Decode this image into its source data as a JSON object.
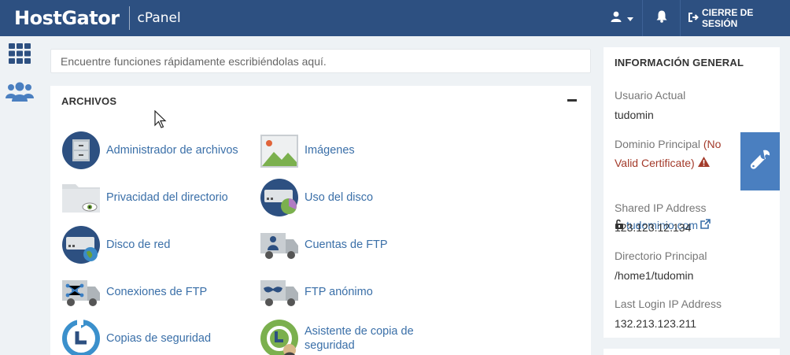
{
  "header": {
    "brand": "HostGator",
    "product": "cPanel",
    "logout_label": "CIERRE DE SESIÓN"
  },
  "rail": {
    "items": [
      {
        "icon": "grid-icon"
      },
      {
        "icon": "users-icon"
      }
    ]
  },
  "search": {
    "placeholder": "Encuentre funciones rápidamente escribiéndolas aquí."
  },
  "files": {
    "title": "ARCHIVOS",
    "items": [
      {
        "label": "Administrador de archivos",
        "icon": "file-manager-icon"
      },
      {
        "label": "Imágenes",
        "icon": "images-icon"
      },
      {
        "label": "Privacidad del directorio",
        "icon": "directory-privacy-icon"
      },
      {
        "label": "Uso del disco",
        "icon": "disk-usage-icon"
      },
      {
        "label": "Disco de red",
        "icon": "network-disk-icon"
      },
      {
        "label": "Cuentas de FTP",
        "icon": "ftp-accounts-icon"
      },
      {
        "label": "Conexiones de FTP",
        "icon": "ftp-connections-icon"
      },
      {
        "label": "FTP anónimo",
        "icon": "anonymous-ftp-icon"
      },
      {
        "label": "Copias de seguridad",
        "icon": "backup-icon"
      },
      {
        "label_line1": "Asistente de copia de",
        "label_line2": "seguridad",
        "icon": "backup-wizard-icon"
      }
    ]
  },
  "info": {
    "title": "INFORMACIÓN GENERAL",
    "current_user_label": "Usuario Actual",
    "current_user": "tudomin",
    "main_domain_label": "Dominio Principal",
    "main_domain_warning_open": "(No",
    "main_domain_warning_close": "Valid Certificate)",
    "main_domain": "tudominio.com",
    "shared_ip_label": "Shared IP Address",
    "shared_ip": "123.123.12.134",
    "home_dir_label": "Directorio Principal",
    "home_dir": "/home1/tudomin",
    "last_login_label": "Last Login IP Address",
    "last_login": "132.213.123.211"
  },
  "colors": {
    "topbar": "#2d5081",
    "link": "#3a6fa8",
    "warning": "#a33a2a",
    "tool_tab": "#4a7fc0"
  }
}
